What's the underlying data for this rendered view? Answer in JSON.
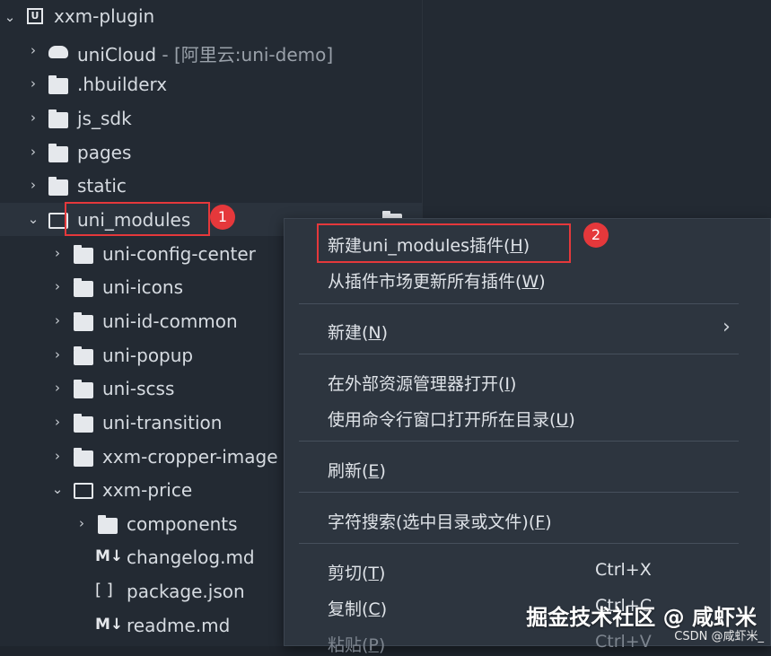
{
  "tree": {
    "root": {
      "label": "xxm-plugin"
    },
    "items": [
      {
        "label": "uniCloud",
        "suffix": " - [阿里云:uni-demo]"
      },
      {
        "label": ".hbuilderx"
      },
      {
        "label": "js_sdk"
      },
      {
        "label": "pages"
      },
      {
        "label": "static"
      },
      {
        "label": "uni_modules"
      },
      {
        "label": "uni-config-center"
      },
      {
        "label": "uni-icons"
      },
      {
        "label": "uni-id-common"
      },
      {
        "label": "uni-popup"
      },
      {
        "label": "uni-scss"
      },
      {
        "label": "uni-transition"
      },
      {
        "label": "xxm-cropper-image"
      },
      {
        "label": "xxm-price"
      },
      {
        "label": "components"
      },
      {
        "label": "changelog.md"
      },
      {
        "label": "package.json"
      },
      {
        "label": "readme.md"
      }
    ],
    "icons": {
      "md": "M↓",
      "json": "[ ]",
      "project": "U"
    }
  },
  "annotations": {
    "badge1": "1",
    "badge2": "2"
  },
  "context_menu": {
    "new_plugin": {
      "text": "新建uni_modules插件(",
      "key": "H",
      "end": ")"
    },
    "update_all": {
      "text": "从插件市场更新所有插件(",
      "key": "W",
      "end": ")"
    },
    "new": {
      "text": "新建(",
      "key": "N",
      "end": ")"
    },
    "open_explorer": {
      "text": "在外部资源管理器打开(",
      "key": "I",
      "end": ")"
    },
    "open_terminal": {
      "text": "使用命令行窗口打开所在目录(",
      "key": "U",
      "end": ")"
    },
    "refresh": {
      "text": "刷新(",
      "key": "E",
      "end": ")"
    },
    "search": {
      "text": "字符搜索(选中目录或文件)(",
      "key": "F",
      "end": ")"
    },
    "cut": {
      "text": "剪切(",
      "key": "T",
      "end": ")",
      "shortcut": "Ctrl+X"
    },
    "copy": {
      "text": "复制(",
      "key": "C",
      "end": ")",
      "shortcut": "Ctrl+C"
    },
    "paste": {
      "text": "粘贴(",
      "key": "P",
      "end": ")",
      "shortcut": "Ctrl+V"
    }
  },
  "watermark": {
    "main": "掘金技术社区 @ 咸虾米",
    "sub": "CSDN @咸虾米_"
  },
  "colors": {
    "highlight": "#e5383b",
    "menu_bg": "#2d353f",
    "tree_bg": "#232a33"
  }
}
